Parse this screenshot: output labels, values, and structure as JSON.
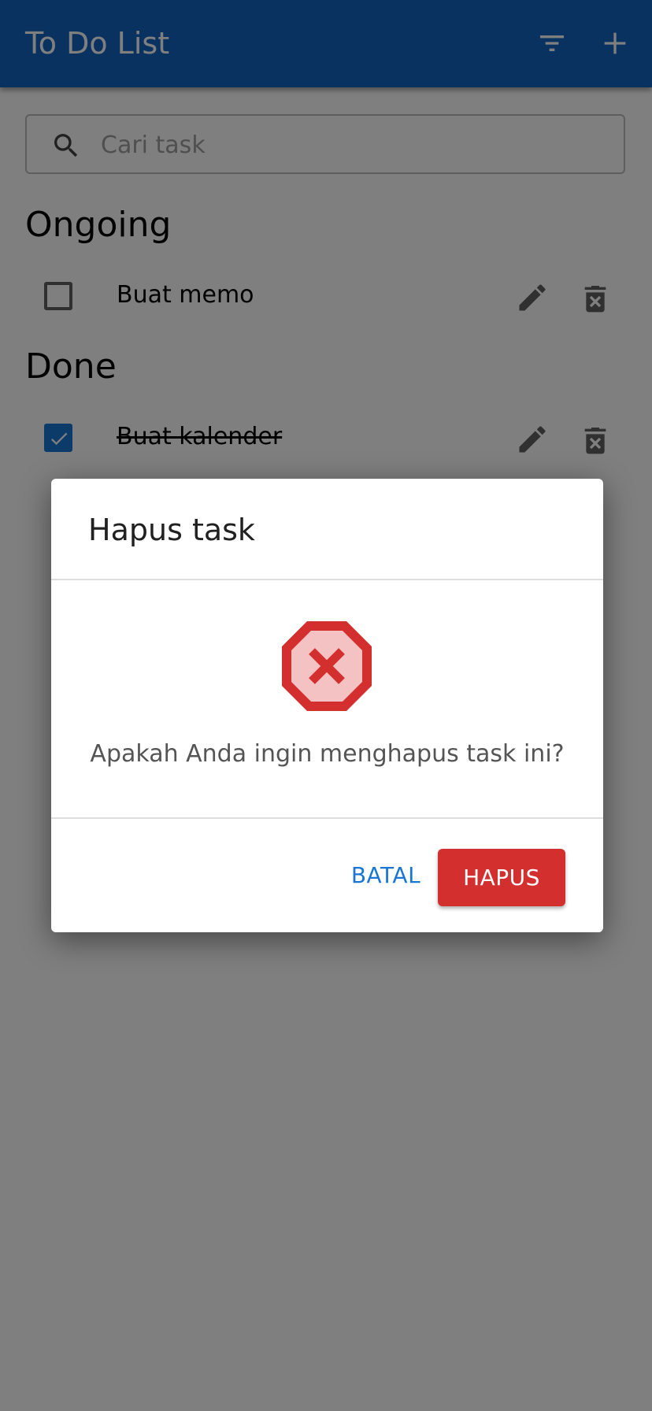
{
  "appbar": {
    "title": "To Do List",
    "filter_icon": "filter-icon",
    "add_icon": "plus-icon",
    "color": "#1565c0"
  },
  "search": {
    "placeholder": "Cari task",
    "value": "",
    "icon": "search-icon"
  },
  "sections": {
    "ongoing": {
      "title": "Ongoing",
      "tasks": [
        {
          "label": "Buat memo",
          "checked": false
        }
      ]
    },
    "done": {
      "title": "Done",
      "tasks": [
        {
          "label": "Buat kalender",
          "checked": true
        }
      ]
    }
  },
  "row_icons": {
    "edit": "pencil-icon",
    "delete": "trash-icon"
  },
  "dialog": {
    "title": "Hapus task",
    "icon": "error-octagon-icon",
    "message": "Apakah Anda ingin menghapus task ini?",
    "cancel_label": "BATAL",
    "confirm_label": "HAPUS",
    "confirm_color": "#d32f2f",
    "cancel_color": "#1976d2"
  }
}
